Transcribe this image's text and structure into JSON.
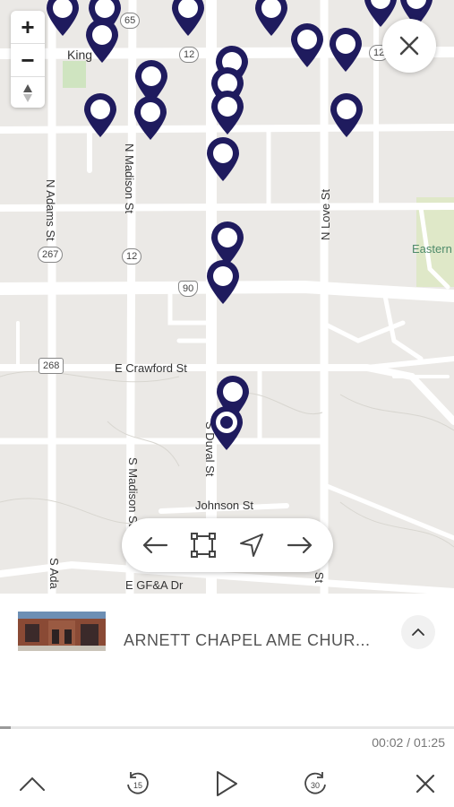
{
  "map": {
    "streets": [
      {
        "id": "n-adams",
        "label": "N Adams St"
      },
      {
        "id": "n-madison",
        "label": "N Madison St"
      },
      {
        "id": "n-love",
        "label": "N Love St"
      },
      {
        "id": "e-crawford",
        "label": "E Crawford St"
      },
      {
        "id": "s-madison",
        "label": "S Madison St"
      },
      {
        "id": "s-duval",
        "label": "S Duval St"
      },
      {
        "id": "johnson",
        "label": "Johnson St"
      },
      {
        "id": "e-gfa",
        "label": "E GF&A Dr"
      },
      {
        "id": "s-ada",
        "label": "S Ada"
      },
      {
        "id": "love-st-s",
        "label": "Love St"
      },
      {
        "id": "king",
        "label": "King"
      },
      {
        "id": "eastern",
        "label": "Eastern"
      }
    ],
    "shields": [
      {
        "id": "r65",
        "label": "65"
      },
      {
        "id": "r12a",
        "label": "12"
      },
      {
        "id": "r12b",
        "label": "12"
      },
      {
        "id": "r12c",
        "label": "12"
      },
      {
        "id": "r267",
        "label": "267"
      },
      {
        "id": "r90",
        "label": "90"
      },
      {
        "id": "r268",
        "label": "268"
      }
    ],
    "pin_color": "#1f1b5e",
    "zoom_in": "+",
    "zoom_out": "−",
    "compass_icon": "north-arrow-icon"
  },
  "navigation": {
    "prev_icon": "arrow-left-icon",
    "fit_icon": "frame-icon",
    "locate_icon": "location-arrow-icon",
    "next_icon": "arrow-right-icon",
    "close_icon": "close-icon"
  },
  "player": {
    "title": "ARNETT CHAPEL AME CHUR...",
    "elapsed": "00:02",
    "duration": "01:25",
    "time_display": "00:02 / 01:25",
    "progress": 0.024,
    "rewind_label": "15",
    "forward_label": "30",
    "expand_icon": "chevron-up-icon",
    "collapse_icon": "chevron-up-icon",
    "play_icon": "play-icon",
    "close_icon": "close-icon"
  }
}
